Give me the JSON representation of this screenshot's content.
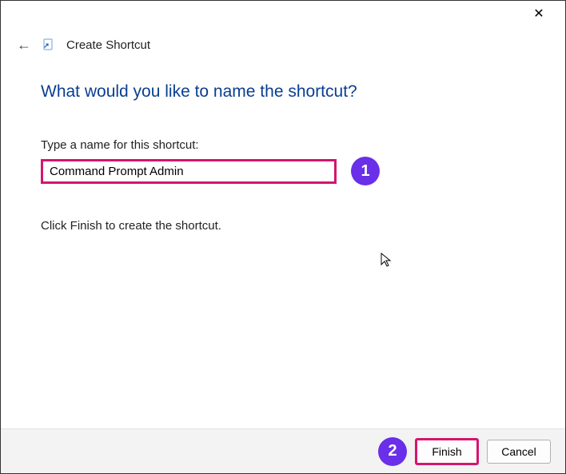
{
  "titlebar": {
    "close_glyph": "✕"
  },
  "header": {
    "back_glyph": "←",
    "wizard_title": "Create Shortcut"
  },
  "content": {
    "heading": "What would you like to name the shortcut?",
    "name_label": "Type a name for this shortcut:",
    "name_value": "Command Prompt Admin",
    "hint": "Click Finish to create the shortcut."
  },
  "annotations": {
    "badge1": "1",
    "badge2": "2"
  },
  "footer": {
    "finish_label": "Finish",
    "cancel_label": "Cancel"
  }
}
